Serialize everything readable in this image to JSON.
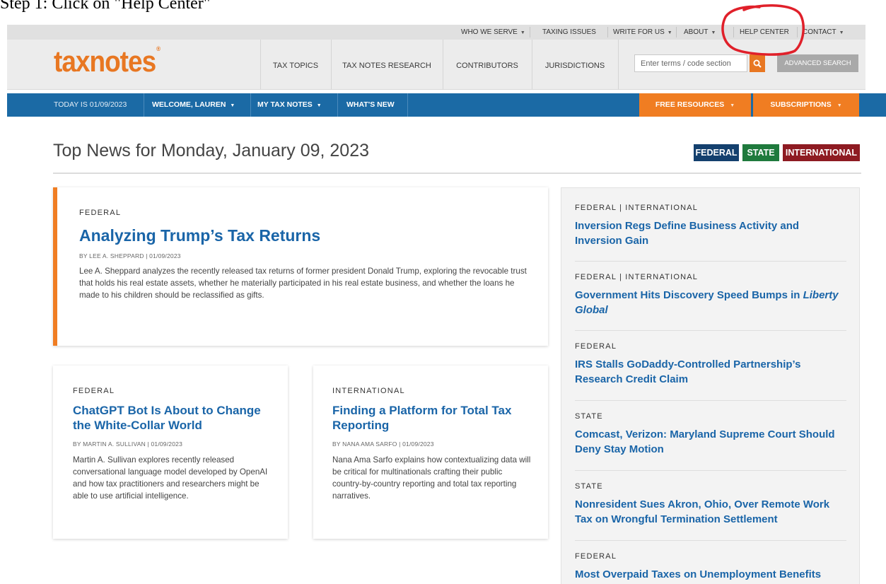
{
  "caption": "Step 1: Click on \"Help Center\"",
  "utility_nav": {
    "items": [
      {
        "label": "WHO WE SERVE",
        "dropdown": true
      },
      {
        "label": "TAXING ISSUES",
        "dropdown": false
      },
      {
        "label": "WRITE FOR US",
        "dropdown": true
      },
      {
        "label": "ABOUT",
        "dropdown": true
      },
      {
        "label": "HELP CENTER",
        "dropdown": false
      },
      {
        "label": "CONTACT",
        "dropdown": true
      }
    ]
  },
  "header": {
    "logo": "taxnotes",
    "logo_mark": "®",
    "nav": [
      "TAX TOPICS",
      "TAX NOTES RESEARCH",
      "CONTRIBUTORS",
      "JURISDICTIONS"
    ],
    "search_placeholder": "Enter terms / code section",
    "advanced_search": "ADVANCED SEARCH"
  },
  "bluebar": {
    "today": "TODAY IS 01/09/2023",
    "welcome": "WELCOME, LAUREN",
    "my_tax_notes": "MY TAX NOTES",
    "whats_new": "WHAT'S NEW",
    "free_resources": "FREE RESOURCES",
    "subscriptions": "SUBSCRIPTIONS"
  },
  "main": {
    "page_title": "Top News for Monday, January 09, 2023",
    "regions": [
      {
        "label": "FEDERAL",
        "color": "#14406e"
      },
      {
        "label": "STATE",
        "color": "#1f7a3d"
      },
      {
        "label": "INTERNATIONAL",
        "color": "#8e1b22"
      }
    ],
    "featured": {
      "kicker": "FEDERAL",
      "headline": "Analyzing Trump’s Tax Returns",
      "byline": "BY LEE A. SHEPPARD | 01/09/2023",
      "summary": "Lee A. Sheppard analyzes the recently released tax returns of former president Donald Trump, exploring the revocable trust that holds his real estate assets, whether he materially participated in his real estate business, and whether the loans he made to his children should be reclassified as gifts."
    },
    "cards": [
      {
        "kicker": "FEDERAL",
        "headline": "ChatGPT Bot Is About to Change the White-Collar World",
        "byline": "BY MARTIN A. SULLIVAN | 01/09/2023",
        "summary": "Martin A. Sullivan explores recently released conversational language model developed by OpenAI and how tax practitioners and researchers might be able to use artificial intelligence."
      },
      {
        "kicker": "INTERNATIONAL",
        "headline": "Finding a Platform for Total Tax Reporting",
        "byline": "BY NANA AMA SARFO | 01/09/2023",
        "summary": "Nana Ama Sarfo explains how contextualizing data will be critical for multinationals crafting their public country-by-country reporting and total tax reporting narratives."
      }
    ]
  },
  "sidebar": {
    "items": [
      {
        "kicker": "FEDERAL | INTERNATIONAL",
        "headline": "Inversion Regs Define Business Activity and Inversion Gain"
      },
      {
        "kicker": "FEDERAL | INTERNATIONAL",
        "headline": "Government Hits Discovery Speed Bumps in",
        "headline_italic": "Liberty Global"
      },
      {
        "kicker": "FEDERAL",
        "headline": "IRS Stalls GoDaddy-Controlled Partnership’s Research Credit Claim"
      },
      {
        "kicker": "STATE",
        "headline": "Comcast, Verizon: Maryland Supreme Court Should Deny Stay Motion"
      },
      {
        "kicker": "STATE",
        "headline": "Nonresident Sues Akron, Ohio, Over Remote Work Tax on Wrongful Termination Settlement"
      },
      {
        "kicker": "FEDERAL",
        "headline": "Most Overpaid Taxes on Unemployment Benefits"
      }
    ]
  },
  "colors": {
    "brand_orange": "#f07d22",
    "link_blue": "#1a65a8",
    "nav_blue": "#1b6aa5",
    "annotation_red": "#e0202a"
  },
  "icons": {
    "search": "search-icon",
    "caret": "caret-down-icon"
  }
}
